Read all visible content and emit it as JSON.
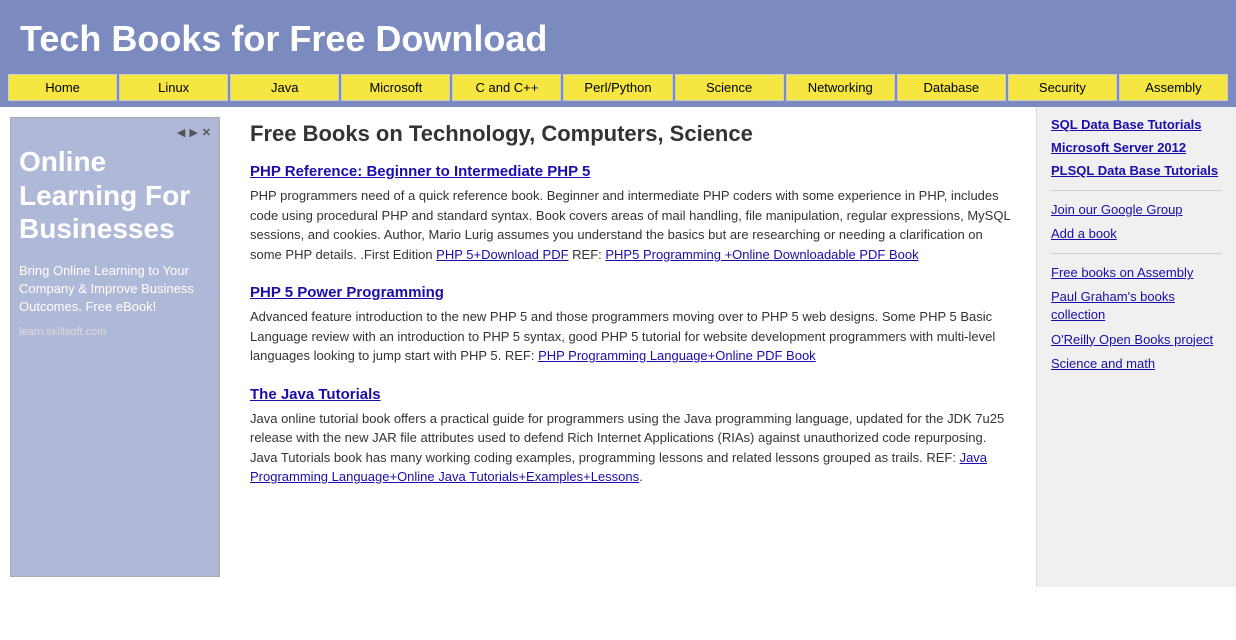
{
  "header": {
    "title": "Tech Books for Free Download"
  },
  "nav": {
    "items": [
      {
        "label": "Home",
        "id": "home"
      },
      {
        "label": "Linux",
        "id": "linux"
      },
      {
        "label": "Java",
        "id": "java"
      },
      {
        "label": "Microsoft",
        "id": "microsoft"
      },
      {
        "label": "C and C++",
        "id": "c-cpp"
      },
      {
        "label": "Perl/Python",
        "id": "perl-python"
      },
      {
        "label": "Science",
        "id": "science"
      },
      {
        "label": "Networking",
        "id": "networking"
      },
      {
        "label": "Database",
        "id": "database"
      },
      {
        "label": "Security",
        "id": "security"
      },
      {
        "label": "Assembly",
        "id": "assembly"
      }
    ]
  },
  "ad": {
    "headline": "Online Learning For Businesses",
    "body": "Bring Online Learning to Your Company & Improve Business Outcomes. Free eBook!",
    "footer": "learn.skillsoft.com"
  },
  "main": {
    "heading": "Free Books on Technology, Computers, Science",
    "books": [
      {
        "id": "book1",
        "title": "PHP Reference: Beginner to Intermediate PHP 5",
        "description": "PHP programmers need of a quick reference book. Beginner and intermediate PHP coders with some experience in PHP, includes code using procedural PHP and standard syntax. Book covers areas of mail handling, file manipulation, regular expressions, MySQL sessions, and cookies. Author, Mario Lurig assumes you understand the basics but are researching or needing a clarification on some PHP details. .First Edition",
        "links": [
          {
            "text": "PHP 5+Download PDF",
            "url": "#"
          },
          {
            "text": "PHP5 Programming +Online Downloadable PDF Book",
            "url": "#"
          }
        ],
        "link_prefix": " REF: ",
        "link_separator": " REF: "
      },
      {
        "id": "book2",
        "title": "PHP 5 Power Programming",
        "description": "Advanced feature introduction to the new PHP 5 and those programmers moving over to PHP 5 web designs. Some PHP 5 Basic Language review with an introduction to PHP 5 syntax, good PHP 5 tutorial for website development programmers with multi-level languages looking to jump start with PHP 5. REF:",
        "links": [
          {
            "text": "PHP Programming Language+Online PDF Book",
            "url": "#"
          }
        ]
      },
      {
        "id": "book3",
        "title": "The Java Tutorials",
        "description": "Java online tutorial book offers a practical guide for programmers using the Java programming language, updated for the JDK 7u25 release with the new JAR file attributes used to defend Rich Internet Applications (RIAs) against unauthorized code repurposing. Java Tutorials book has many working coding examples, programming lessons and related lessons grouped as trails. REF:",
        "links": [
          {
            "text": "Java Programming Language+Online Java Tutorials+Examples+Lessons",
            "url": "#"
          }
        ]
      }
    ]
  },
  "right_sidebar": {
    "bold_links": [
      {
        "text": "SQL Data Base Tutorials",
        "url": "#"
      },
      {
        "text": "Microsoft Server 2012",
        "url": "#"
      },
      {
        "text": "PLSQL Data Base Tutorials",
        "url": "#"
      }
    ],
    "normal_links": [
      {
        "text": "Join our Google Group",
        "url": "#"
      },
      {
        "text": "Add a book",
        "url": "#"
      },
      {
        "text": "Free books on Assembly",
        "url": "#"
      },
      {
        "text": "Paul Graham's books collection",
        "url": "#"
      },
      {
        "text": "O'Reilly Open Books project",
        "url": "#"
      },
      {
        "text": "Science and math",
        "url": "#"
      }
    ]
  }
}
